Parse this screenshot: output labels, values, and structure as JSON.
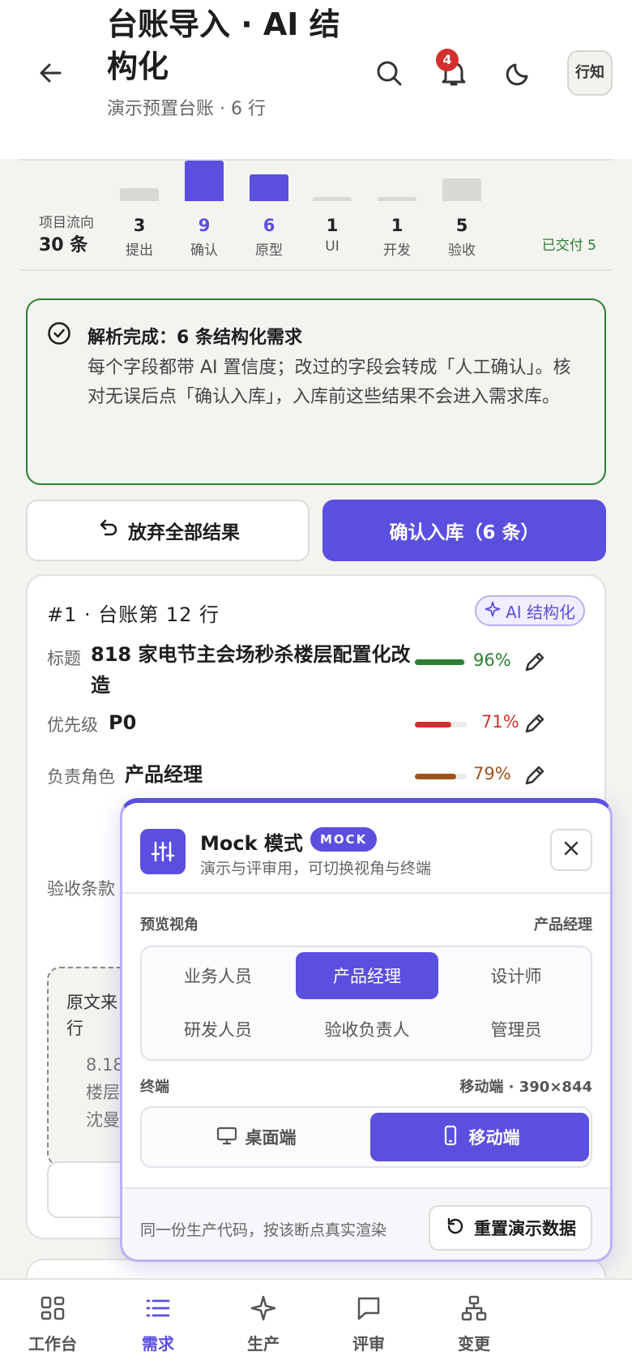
{
  "header": {
    "title": "台账导入 · AI 结构化",
    "subtitle": "演示预置台账 · 6 行",
    "notification_count": "4",
    "avatar_text": "行知"
  },
  "flow": {
    "label": "项目流向",
    "count": "30 条",
    "stages": [
      {
        "name": "提出",
        "count": 3,
        "highlight": false
      },
      {
        "name": "确认",
        "count": 9,
        "highlight": true
      },
      {
        "name": "原型",
        "count": 6,
        "highlight": true
      },
      {
        "name": "UI",
        "count": 1,
        "highlight": false
      },
      {
        "name": "开发",
        "count": 1,
        "highlight": false
      },
      {
        "name": "验收",
        "count": 5,
        "highlight": false
      }
    ],
    "delivered": "已交付 5"
  },
  "notice": {
    "title": "解析完成：6 条结构化需求",
    "body": "每个字段都带 AI 置信度；改过的字段会转成「人工确认」。核对无误后点「确认入库」，入库前这些结果不会进入需求库。"
  },
  "actions": {
    "discard_label": "放弃全部结果",
    "confirm_label": "确认入库（6 条）"
  },
  "card": {
    "header": "#1 · 台账第 12 行",
    "ai_chip": "AI 结构化",
    "fields": [
      {
        "label": "标题",
        "value": "818 家电节主会场秒杀楼层配置化改造",
        "confidence": 0.96,
        "pct": "96%",
        "color": "#2e7d32"
      },
      {
        "label": "优先级",
        "value": "P0",
        "confidence": 0.71,
        "pct": "71%",
        "color": "#d32f2f"
      },
      {
        "label": "负责角色",
        "value": "产品经理",
        "confidence": 0.79,
        "pct": "79%",
        "color": "#a0521b"
      }
    ],
    "acceptance_label": "验收条款",
    "source_title": "原文来\n行",
    "source_text": "8.18\n楼层\n沈曼"
  },
  "mock_panel": {
    "title": "Mock 模式",
    "tag": "MOCK",
    "subtitle": "演示与评审用，可切换视角与终端",
    "view_label": "预览视角",
    "view_selected": "产品经理",
    "roles": [
      "业务人员",
      "产品经理",
      "设计师",
      "研发人员",
      "验收负责人",
      "管理员"
    ],
    "active_role": 1,
    "terminal_label": "终端",
    "terminal_selected": "移动端 · 390×844",
    "terminals": [
      "桌面端",
      "移动端"
    ],
    "footer_text": "同一份生产代码，按该断点真实渲染",
    "reset_label": "重置演示数据"
  },
  "bottom_nav": {
    "items": [
      {
        "label": "工作台",
        "icon": "grid-icon"
      },
      {
        "label": "需求",
        "icon": "list-icon"
      },
      {
        "label": "生产",
        "icon": "sparkle-icon"
      },
      {
        "label": "评审",
        "icon": "comment-icon"
      },
      {
        "label": "变更",
        "icon": "tree-icon"
      }
    ],
    "active": 1
  },
  "colors": {
    "accent": "#5b4fe0",
    "success": "#2e7d32",
    "danger": "#d32f2f",
    "warning": "#a0521b"
  }
}
